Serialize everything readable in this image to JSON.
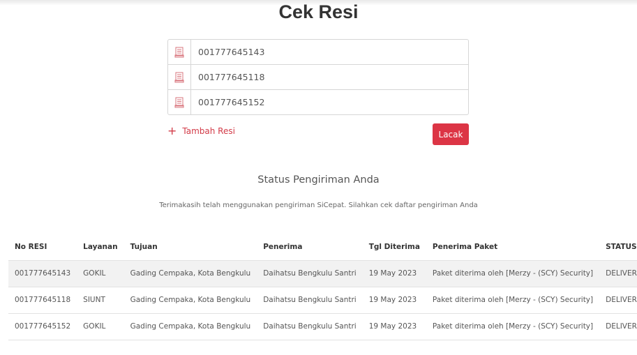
{
  "page": {
    "title": "Cek Resi"
  },
  "form": {
    "inputs": [
      {
        "value": "001777645143"
      },
      {
        "value": "001777645118"
      },
      {
        "value": "001777645152"
      }
    ],
    "add_label": "Tambah Resi",
    "submit_label": "Lacak"
  },
  "status": {
    "title": "Status Pengiriman Anda",
    "subtitle": "Terimakasih telah menggunakan pengiriman SiCepat. Silahkan cek daftar pengiriman Anda"
  },
  "table": {
    "headers": [
      "No RESI",
      "Layanan",
      "Tujuan",
      "Penerima",
      "Tgl Diterima",
      "Penerima Paket",
      "STATUS"
    ],
    "rows": [
      [
        "001777645143",
        "GOKIL",
        "Gading Cempaka, Kota Bengkulu",
        "Daihatsu Bengkulu Santri",
        "19 May 2023",
        "Paket diterima oleh [Merzy - (SCY) Security]",
        "DELIVERED"
      ],
      [
        "001777645118",
        "SIUNT",
        "Gading Cempaka, Kota Bengkulu",
        "Daihatsu Bengkulu Santri",
        "19 May 2023",
        "Paket diterima oleh [Merzy - (SCY) Security]",
        "DELIVERED"
      ],
      [
        "001777645152",
        "GOKIL",
        "Gading Cempaka, Kota Bengkulu",
        "Daihatsu Bengkulu Santri",
        "19 May 2023",
        "Paket diterima oleh [Merzy - (SCY) Security]",
        "DELIVERED"
      ]
    ]
  },
  "colors": {
    "accent": "#dc3545",
    "icon": "#d9757d",
    "row_alt": "#f2f2f2"
  },
  "icons": {
    "resi": "receipt-icon",
    "add": "plus-icon"
  }
}
